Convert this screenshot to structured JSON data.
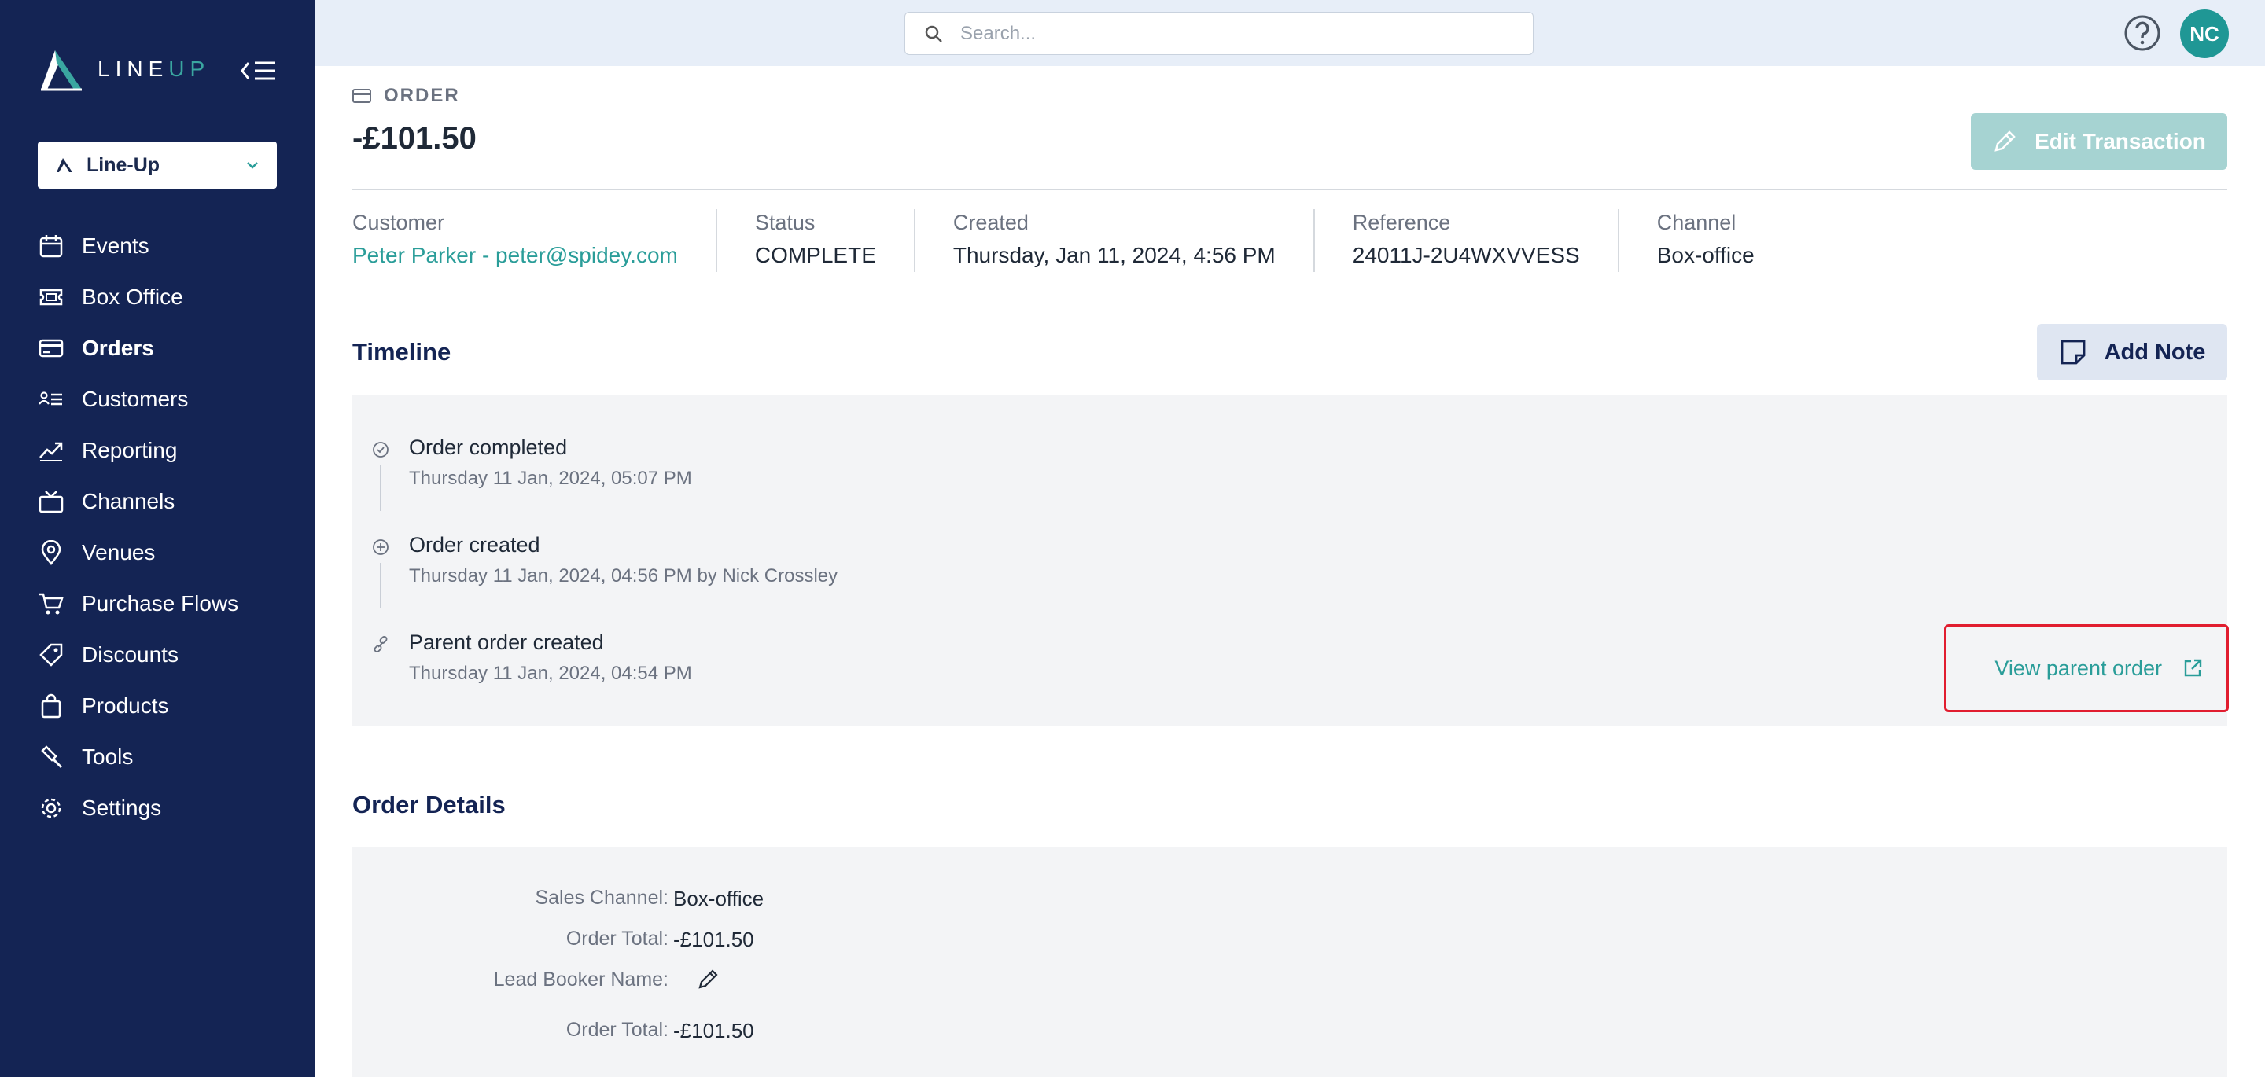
{
  "brand": {
    "logo_text_main": "LINE",
    "logo_text_accent": "UP",
    "accent_color": "#2a9d99",
    "sidebar_color": "#142454"
  },
  "sidebar": {
    "org_name": "Line-Up",
    "items": [
      {
        "label": "Events",
        "icon": "calendar-icon"
      },
      {
        "label": "Box Office",
        "icon": "ticket-icon"
      },
      {
        "label": "Orders",
        "icon": "credit-card-icon",
        "active": true
      },
      {
        "label": "Customers",
        "icon": "customers-icon"
      },
      {
        "label": "Reporting",
        "icon": "chart-line-icon"
      },
      {
        "label": "Channels",
        "icon": "tv-icon"
      },
      {
        "label": "Venues",
        "icon": "map-pin-icon"
      },
      {
        "label": "Purchase Flows",
        "icon": "cart-icon"
      },
      {
        "label": "Discounts",
        "icon": "tag-icon"
      },
      {
        "label": "Products",
        "icon": "bag-icon"
      },
      {
        "label": "Tools",
        "icon": "hammer-icon"
      },
      {
        "label": "Settings",
        "icon": "gear-icon"
      }
    ]
  },
  "topbar": {
    "search_placeholder": "Search...",
    "avatar_initials": "NC"
  },
  "header": {
    "section_label": "ORDER",
    "amount": "-£101.50",
    "edit_button": "Edit Transaction"
  },
  "meta": {
    "customer_label": "Customer",
    "customer_value": "Peter Parker - peter@spidey.com",
    "status_label": "Status",
    "status_value": "COMPLETE",
    "created_label": "Created",
    "created_value": "Thursday, Jan 11, 2024, 4:56 PM",
    "reference_label": "Reference",
    "reference_value": "24011J-2U4WXVVESS",
    "channel_label": "Channel",
    "channel_value": "Box-office"
  },
  "timeline": {
    "title": "Timeline",
    "add_note": "Add Note",
    "events": [
      {
        "title": "Order completed",
        "sub": "Thursday 11 Jan, 2024, 05:07 PM",
        "icon": "check-circle-icon"
      },
      {
        "title": "Order created",
        "sub": "Thursday 11 Jan, 2024, 04:56 PM by Nick Crossley",
        "icon": "plus-circle-icon"
      },
      {
        "title": "Parent order created",
        "sub": "Thursday 11 Jan, 2024, 04:54 PM",
        "icon": "link-icon"
      }
    ],
    "view_parent": "View parent order"
  },
  "order_details": {
    "title": "Order Details",
    "rows": [
      {
        "label": "Sales Channel:",
        "value": "Box-office"
      },
      {
        "label": "Order Total:",
        "value": "-£101.50"
      },
      {
        "label": "Lead Booker Name:",
        "value": ""
      },
      {
        "label": "Order Total:",
        "value": "-£101.50"
      }
    ]
  }
}
